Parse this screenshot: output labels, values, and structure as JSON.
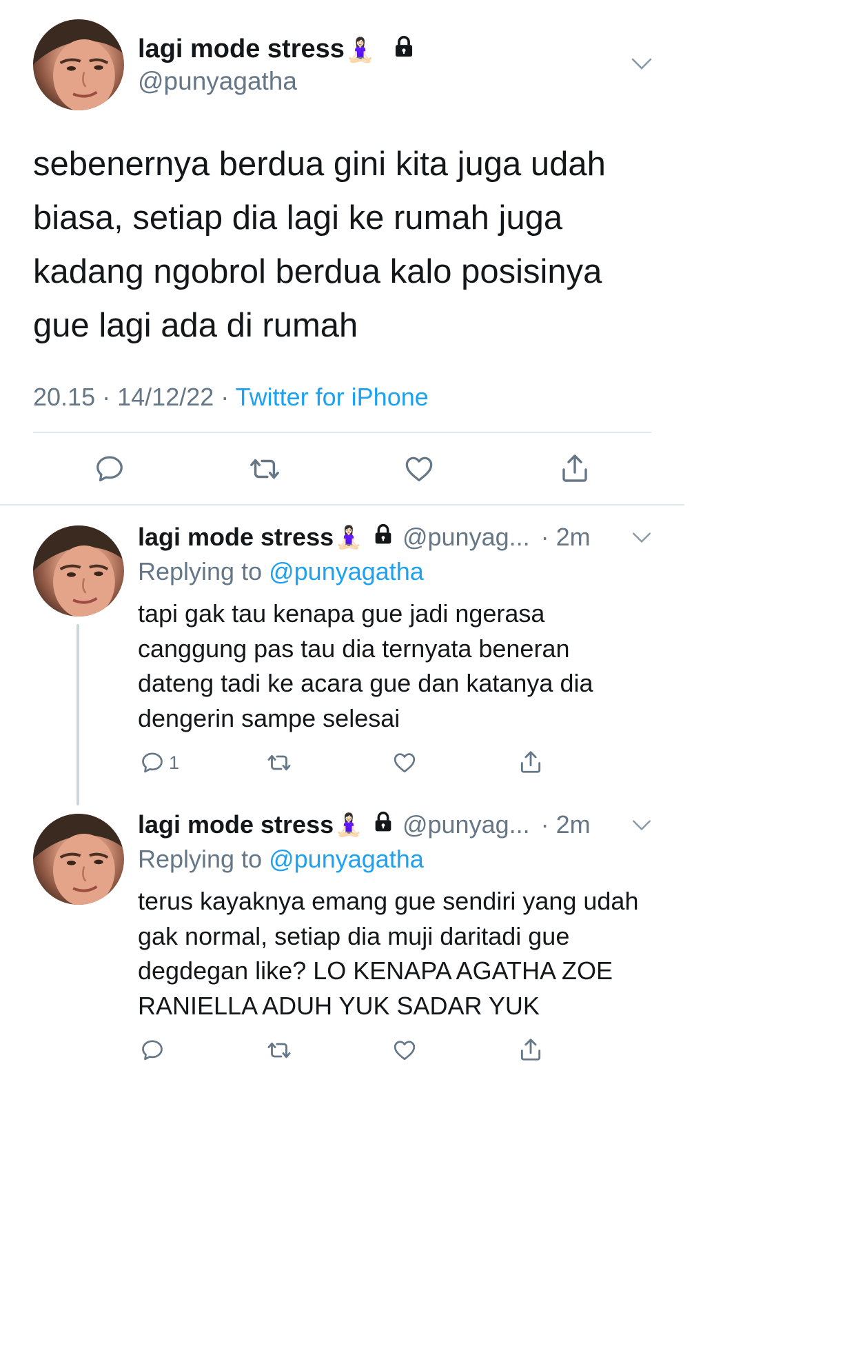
{
  "main_tweet": {
    "display_name": "lagi mode stress",
    "emoji": "🧘🏻‍♀️",
    "lock_icon": "lock-icon",
    "handle": "@punyagatha",
    "text": "sebenernya berdua gini kita juga udah biasa, setiap dia lagi ke rumah juga kadang ngobrol berdua kalo posisinya gue lagi ada di rumah",
    "time": "20.15",
    "date": "14/12/22",
    "separator": "·",
    "source": "Twitter for iPhone"
  },
  "replies": [
    {
      "display_name": "lagi mode stress",
      "handle": "@punyag...",
      "time_ago": "· 2m",
      "replying_prefix": "Replying to ",
      "replying_to": "@punyagatha",
      "text": "tapi gak tau kenapa gue jadi ngerasa canggung pas tau dia ternyata beneran dateng tadi ke acara gue dan katanya dia dengerin sampe selesai",
      "reply_count": "1"
    },
    {
      "display_name": "lagi mode stress",
      "handle": "@punyag...",
      "time_ago": "· 2m",
      "replying_prefix": "Replying to ",
      "replying_to": "@punyagatha",
      "text": "terus kayaknya emang gue sendiri yang udah gak normal, setiap dia muji daritadi gue degdegan like? LO KENAPA AGATHA ZOE RANIELLA ADUH YUK SADAR YUK",
      "reply_count": ""
    }
  ],
  "colors": {
    "text": "#14171a",
    "secondary": "#657786",
    "link": "#1da1f2",
    "divider": "#e1e8ed",
    "thread_line": "#ccd6dd"
  }
}
